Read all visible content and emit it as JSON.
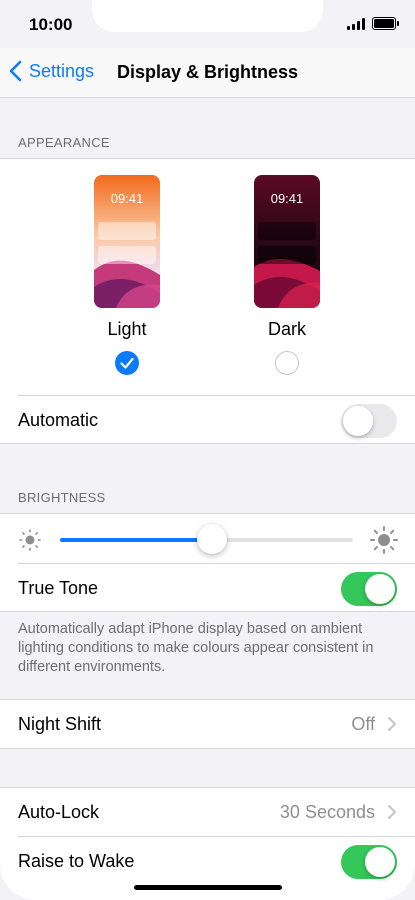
{
  "status_bar": {
    "time": "10:00"
  },
  "nav": {
    "back_label": "Settings",
    "title": "Display & Brightness"
  },
  "appearance": {
    "header": "APPEARANCE",
    "options": [
      {
        "label": "Light",
        "preview_time": "09:41",
        "selected": true
      },
      {
        "label": "Dark",
        "preview_time": "09:41",
        "selected": false
      }
    ],
    "automatic": {
      "label": "Automatic",
      "on": false
    }
  },
  "brightness": {
    "header": "BRIGHTNESS",
    "level": 0.52,
    "true_tone": {
      "label": "True Tone",
      "on": true
    },
    "footer": "Automatically adapt iPhone display based on ambient lighting conditions to make colours appear consistent in different environments."
  },
  "night_shift": {
    "label": "Night Shift",
    "value": "Off"
  },
  "lock": {
    "auto_lock": {
      "label": "Auto-Lock",
      "value": "30 Seconds"
    },
    "raise_to_wake": {
      "label": "Raise to Wake",
      "on": true
    }
  },
  "colors": {
    "accent": "#0a7aff",
    "toggle_on": "#34c759",
    "toggle_off": "#e9e9eb",
    "background": "#f2f2f7"
  }
}
